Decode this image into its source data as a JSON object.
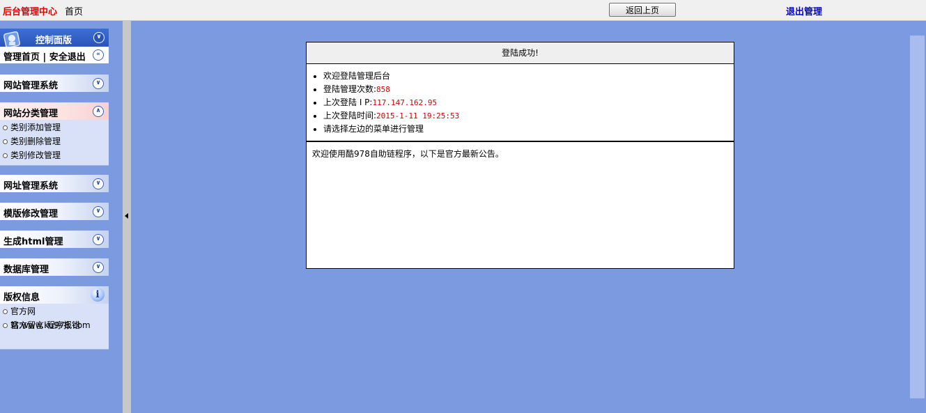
{
  "topbar": {
    "brand": "后台管理中心",
    "home": "首页",
    "back_button": "返回上页",
    "logout": "退出管理"
  },
  "sidebar": {
    "panel_title": "控制面版",
    "quicklinks": "管理首页 | 安全退出",
    "sections": [
      {
        "label": "网站管理系统",
        "state": "collapsed"
      },
      {
        "label": "网站分类管理",
        "state": "expanded",
        "items": [
          "类别添加管理",
          "类别删除管理",
          "类别修改管理"
        ]
      },
      {
        "label": "网址管理系统",
        "state": "collapsed"
      },
      {
        "label": "模版修改管理",
        "state": "collapsed"
      },
      {
        "label": "生成html管理",
        "state": "collapsed"
      },
      {
        "label": "数据库管理",
        "state": "collapsed"
      }
    ],
    "copyright": {
      "label": "版权信息",
      "items": [
        "官方网站:www.ku978.com",
        "官方留言:程序报错"
      ]
    }
  },
  "main": {
    "title": "登陆成功!",
    "welcome": "欢迎登陆管理后台",
    "login_count_label": "登陆管理次数:",
    "login_count": "858",
    "last_ip_label": "上次登陆 I P:",
    "last_ip": "117.147.162.95",
    "last_time_label": "上次登陆时间:",
    "last_time": "2015-1-11 19:25:53",
    "instruction": "请选择左边的菜单进行管理",
    "notice": "欢迎使用酷978自助链程序，以下是官方最新公告。"
  },
  "colors": {
    "background": "#7b9ae0",
    "brand": "#e00000",
    "logout": "#0000cc",
    "value_red": "#d00000"
  }
}
